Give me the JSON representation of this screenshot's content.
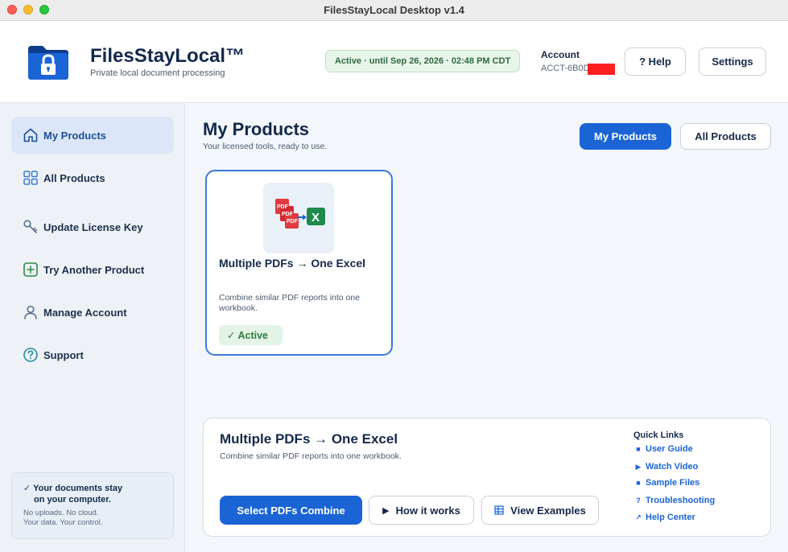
{
  "window": {
    "title": "FilesStayLocal Desktop v1.4"
  },
  "header": {
    "brand_name": "FilesStayLocal™",
    "brand_tagline": "Private local document processing",
    "status": "Active · until Sep 26, 2026 · 02:48 PM CDT",
    "account_label": "Account",
    "account_id": "ACCT-6B0D",
    "help_label": "? Help",
    "settings_label": "Settings"
  },
  "sidebar": {
    "items": [
      {
        "label": "My Products",
        "icon": "home-icon",
        "active": true
      },
      {
        "label": "All Products",
        "icon": "grid-icon",
        "active": false
      },
      {
        "label": "Update License Key",
        "icon": "key-icon",
        "active": false
      },
      {
        "label": "Try Another Product",
        "icon": "plus-square-icon",
        "active": false
      },
      {
        "label": "Manage Account",
        "icon": "user-icon",
        "active": false
      },
      {
        "label": "Support",
        "icon": "question-circle-icon",
        "active": false
      }
    ],
    "privacy": {
      "check": "✓",
      "title_line1": "Your documents stay",
      "title_line2": "on your computer.",
      "line1": "No uploads. No cloud.",
      "line2": "Your data. Your control."
    }
  },
  "main": {
    "title": "My Products",
    "subtitle": "Your licensed tools, ready to use.",
    "toggle": {
      "my_label": "My Products",
      "all_label": "All Products"
    },
    "card": {
      "icon_pdf_text": "PDF",
      "icon_excel_text": "X",
      "title": "Multiple PDFs → One Excel",
      "description": "Combine similar PDF reports into one workbook.",
      "badge": "✓  Active"
    },
    "detail": {
      "title": "Multiple PDFs → One Excel",
      "description": "Combine similar PDF reports into one workbook.",
      "primary_label": "Select PDFs  Combine",
      "how_label": "How it works",
      "examples_label": "View Examples"
    },
    "quick_links": {
      "title": "Quick Links",
      "items": [
        {
          "label": "User Guide",
          "icon": "book-icon"
        },
        {
          "label": "Watch Video",
          "icon": "play-icon"
        },
        {
          "label": "Sample Files",
          "icon": "file-icon"
        },
        {
          "label": "Troubleshooting",
          "icon": "question-icon"
        },
        {
          "label": "Help Center",
          "icon": "external-link-icon"
        }
      ]
    }
  },
  "colors": {
    "accent": "#1a64d6",
    "active_green": "#2f7d3e",
    "status_bg": "#e8f5ea",
    "sidebar_active_bg": "#dbe7f8",
    "pdf_red": "#e0393e",
    "excel_green": "#1e8a4c"
  }
}
